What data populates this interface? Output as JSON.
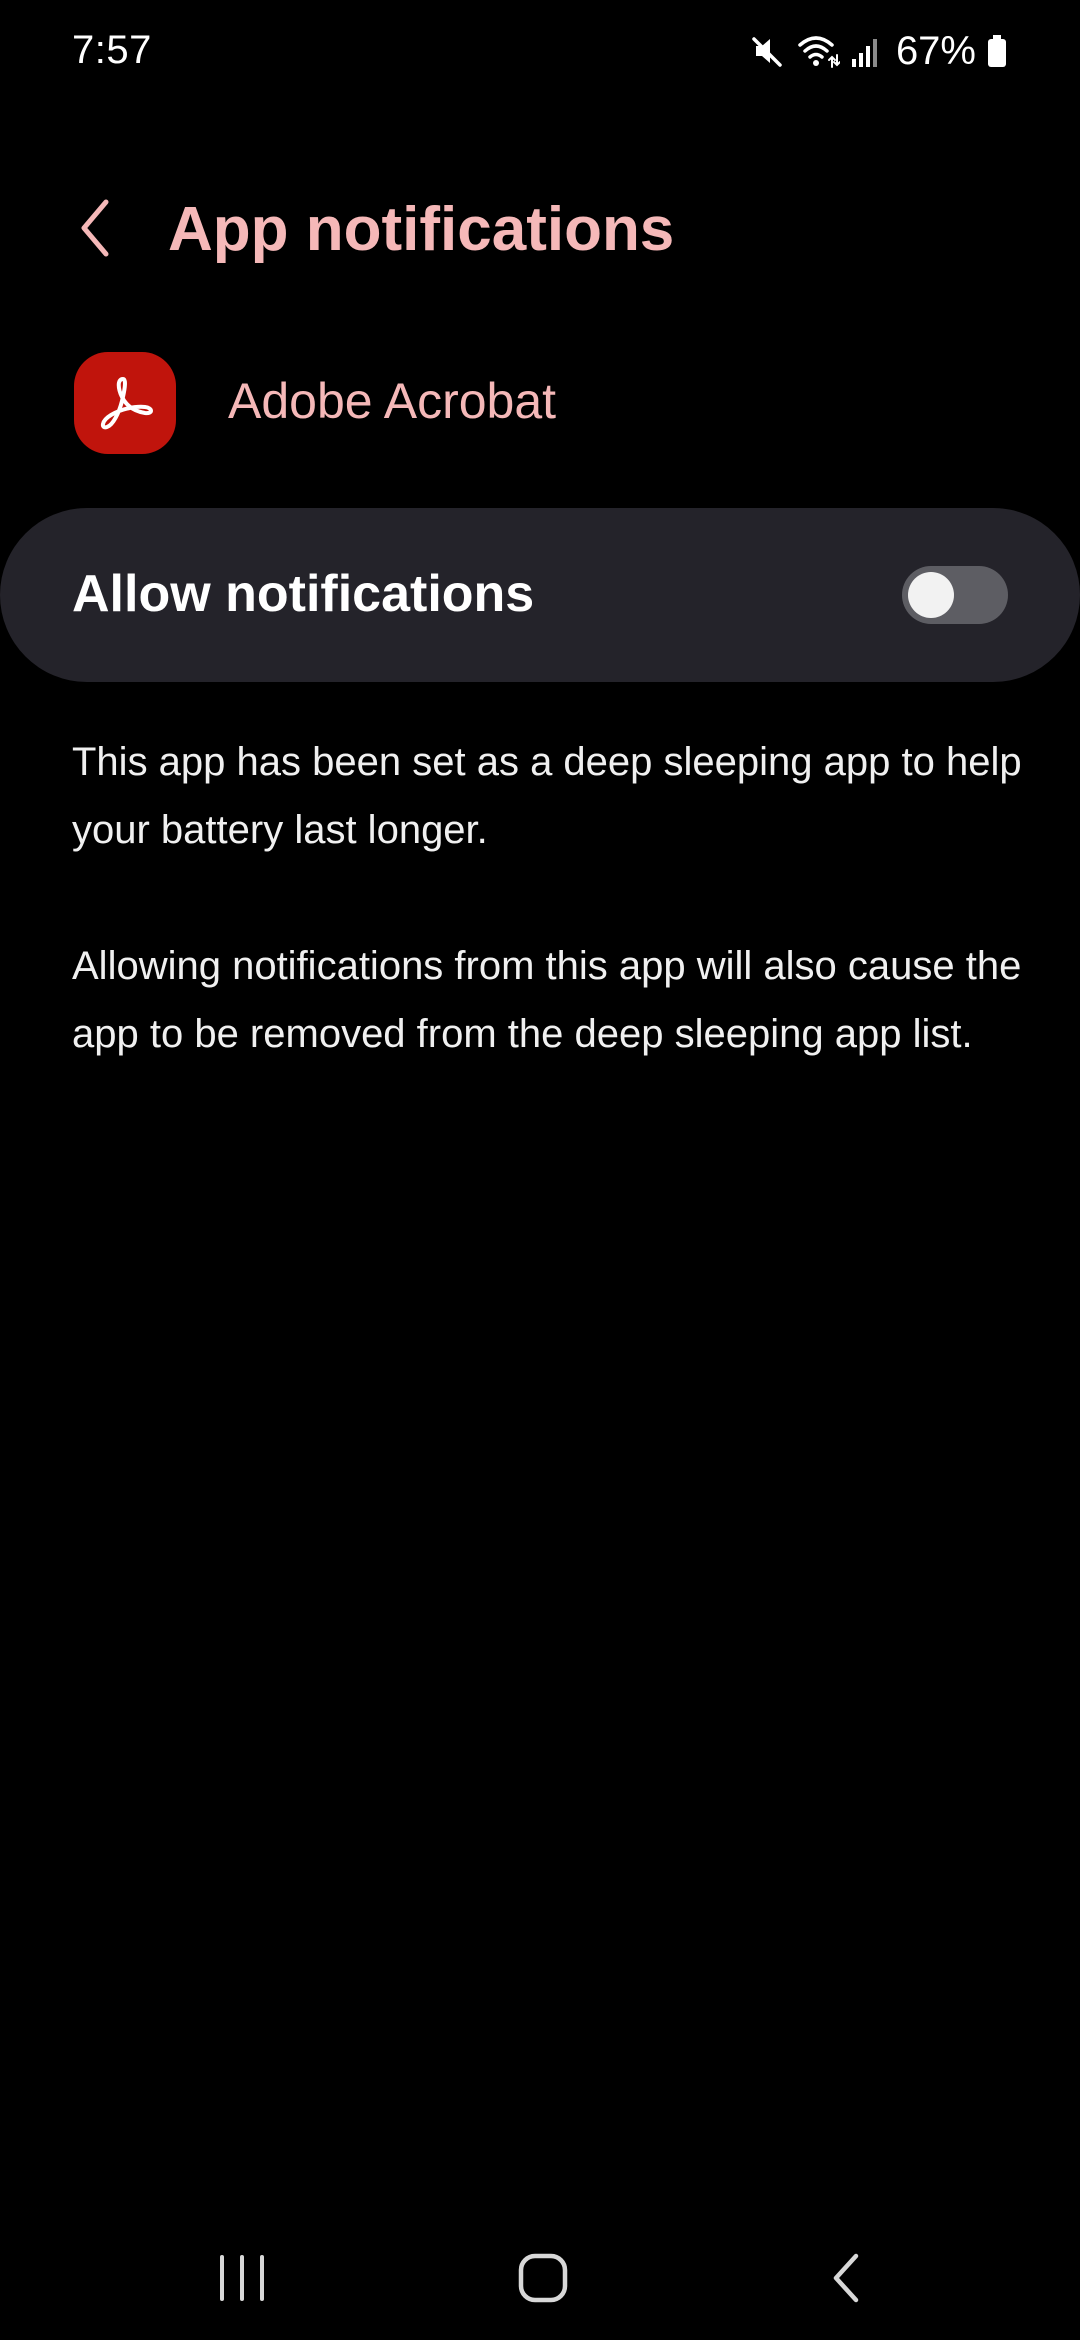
{
  "status_bar": {
    "time": "7:57",
    "battery_percent": "67%",
    "icons": [
      "mute-icon",
      "wifi-icon",
      "signal-icon",
      "battery-icon"
    ]
  },
  "header": {
    "title": "App notifications",
    "back_icon": "chevron-left-icon"
  },
  "app": {
    "name": "Adobe Acrobat",
    "icon": "adobe-acrobat-icon",
    "icon_color": "#c0140c"
  },
  "allow_notifications": {
    "label": "Allow notifications",
    "enabled": false
  },
  "description": {
    "paragraph_1": "This app has been set as a deep sleeping app to help your battery last longer.",
    "paragraph_2": "Allowing notifications from this app will also cause the app to be removed from the deep sleeping app list."
  },
  "nav_bar": {
    "icons": [
      "recents-icon",
      "home-icon",
      "back-icon"
    ]
  },
  "colors": {
    "background": "#000000",
    "accent": "#f5b8b8",
    "card": "#24232a",
    "toggle_off": "#5d5d63"
  }
}
